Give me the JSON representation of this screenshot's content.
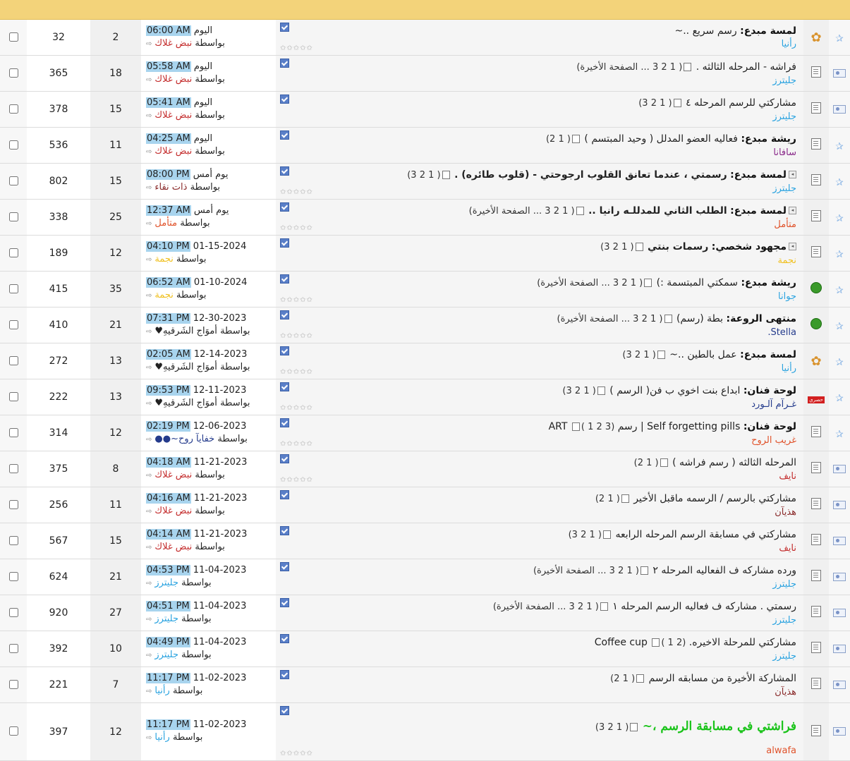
{
  "colors": {
    "header_bar": "#f3d37a",
    "time_highlight": "#a8d4ee",
    "green_title": "#19c319"
  },
  "threads": [
    {
      "views": "32",
      "replies": "2",
      "last_date": "اليوم",
      "last_time": "06:00 AM",
      "last_by_label": "بواسطة",
      "last_by": "نبض غلاك",
      "last_by_color": "c-red",
      "prefix": "لمسة مبدع:",
      "title": "رسم سريع ..~",
      "pages": "",
      "author": "رأنيا",
      "author_color": "c-blue",
      "thread_icon": "flower",
      "status_icon": "pin",
      "stars": true
    },
    {
      "views": "365",
      "replies": "18",
      "last_date": "اليوم",
      "last_time": "05:58 AM",
      "last_by_label": "بواسطة",
      "last_by": "نبض غلاك",
      "last_by_color": "c-red",
      "prefix": "",
      "title": "فراشه - المرحله الثالثه .",
      "pages": "( 1 2 3 ... الصفحة الأخيرة)",
      "author": "جليترز",
      "author_color": "c-blue",
      "thread_icon": "doc",
      "status_icon": "mail",
      "stars": false
    },
    {
      "views": "378",
      "replies": "15",
      "last_date": "اليوم",
      "last_time": "05:41 AM",
      "last_by_label": "بواسطة",
      "last_by": "نبض غلاك",
      "last_by_color": "c-red",
      "prefix": "",
      "title": "مشاركتي للرسم المرحله ٤",
      "pages": "( 1 2 3)",
      "author": "جليترز",
      "author_color": "c-blue",
      "thread_icon": "doc",
      "status_icon": "mail",
      "stars": false
    },
    {
      "views": "536",
      "replies": "11",
      "last_date": "اليوم",
      "last_time": "04:25 AM",
      "last_by_label": "بواسطة",
      "last_by": "نبض غلاك",
      "last_by_color": "c-red",
      "prefix": "ريشة مبدع:",
      "title": "فعاليه العضو المدلل ( وحيد المبتسم )",
      "pages": "( 1 2)",
      "author": "سافانا",
      "author_color": "c-purple",
      "thread_icon": "doc",
      "status_icon": "pin",
      "stars": false
    },
    {
      "views": "802",
      "replies": "15",
      "last_date": "يوم أمس",
      "last_time": "08:00 PM",
      "last_by_label": "بواسطة",
      "last_by": "ذات نقاء",
      "last_by_color": "c-maroon",
      "prefix": "لمسة مبدع:",
      "title": "رسمتي ، عندما تعانق القلوب ارجوحتي - (قلوب طائره) .",
      "pages": "( 1 2 3)",
      "author": "جليترز",
      "author_color": "c-blue",
      "thread_icon": "doc",
      "status_icon": "pin",
      "stars": true,
      "bold_title": true,
      "arrow_box": true
    },
    {
      "views": "338",
      "replies": "25",
      "last_date": "يوم أمس",
      "last_time": "12:37 AM",
      "last_by_label": "بواسطة",
      "last_by": "متأمل",
      "last_by_color": "c-orange",
      "prefix": "لمسة مبدع:",
      "title": "الطلب الثاني للمدللـه رانيا ..",
      "pages": "( 1 2 3 ... الصفحة الأخيرة)",
      "author": "متأمل",
      "author_color": "c-orange",
      "thread_icon": "doc",
      "status_icon": "pin",
      "stars": true,
      "bold_title": true,
      "arrow_box": true
    },
    {
      "views": "189",
      "replies": "12",
      "last_date": "01-15-2024",
      "last_time": "04:10 PM",
      "last_by_label": "بواسطة",
      "last_by": "نجمة",
      "last_by_color": "c-gold",
      "prefix": "مجهود شخصي:",
      "title": "رسمات بنتي",
      "pages": "( 1 2 3)",
      "author": "نجمة",
      "author_color": "c-gold",
      "thread_icon": "doc",
      "status_icon": "pin",
      "stars": false,
      "bold_title": true,
      "arrow_box": true
    },
    {
      "views": "415",
      "replies": "35",
      "last_date": "01-10-2024",
      "last_time": "06:52 AM",
      "last_by_label": "بواسطة",
      "last_by": "نجمة",
      "last_by_color": "c-gold",
      "prefix": "ريشة مبدع:",
      "title": "سمكتي المبتسمة :)",
      "pages": "( 1 2 3 ... الصفحة الأخيرة)",
      "author": "جوانا",
      "author_color": "c-blue",
      "thread_icon": "globe",
      "status_icon": "pin",
      "stars": true
    },
    {
      "views": "410",
      "replies": "21",
      "last_date": "12-30-2023",
      "last_time": "07:31 PM",
      "last_by_label": "بواسطة",
      "last_by": "أموَاج الشَرقيهِ♥",
      "last_by_color": "c-dark",
      "prefix": "منتهى الروعة:",
      "title": "بطة (رسم)",
      "pages": "( 1 2 3 ... الصفحة الأخيرة)",
      "author": "Stella.",
      "author_color": "c-navy",
      "thread_icon": "globe",
      "status_icon": "pin",
      "stars": true
    },
    {
      "views": "272",
      "replies": "13",
      "last_date": "12-14-2023",
      "last_time": "02:05 AM",
      "last_by_label": "بواسطة",
      "last_by": "أموَاج الشَرقيهِ♥",
      "last_by_color": "c-dark",
      "prefix": "لمسة مبدع:",
      "title": "عمل بالطين ..~",
      "pages": "( 1 2 3)",
      "author": "رأنيا",
      "author_color": "c-blue",
      "thread_icon": "flower",
      "status_icon": "pin",
      "stars": true
    },
    {
      "views": "222",
      "replies": "13",
      "last_date": "12-11-2023",
      "last_time": "09:53 PM",
      "last_by_label": "بواسطة",
      "last_by": "أموَاج الشَرقيهِ♥",
      "last_by_color": "c-dark",
      "prefix": "لوحة فنان:",
      "title": "ابداع بنت اخوي ب فن( الرسم )",
      "pages": "( 1 2 3)",
      "author": "غـرآم آلـورد",
      "author_color": "c-navy",
      "thread_icon": "exclusive",
      "thread_icon_label": "حصري",
      "status_icon": "pin",
      "stars": true
    },
    {
      "views": "314",
      "replies": "12",
      "last_date": "12-06-2023",
      "last_time": "02:19 PM",
      "last_by_label": "بواسطة",
      "last_by": "خفايآ روح~●●",
      "last_by_color": "c-navy",
      "prefix": "لوحة فنان:",
      "title": "Self forgetting pills | رسم ART",
      "pages": "( 1 2 3)",
      "author": "غريب الروح",
      "author_color": "c-orange",
      "thread_icon": "doc",
      "status_icon": "pin",
      "stars": true
    },
    {
      "views": "375",
      "replies": "8",
      "last_date": "11-21-2023",
      "last_time": "04:18 AM",
      "last_by_label": "بواسطة",
      "last_by": "نبض غلاك",
      "last_by_color": "c-red",
      "prefix": "",
      "title": "المرحله الثالثه ( رسم فراشه )",
      "pages": "( 1 2)",
      "author": "نايف",
      "author_color": "c-red",
      "thread_icon": "doc",
      "status_icon": "mail",
      "stars": true
    },
    {
      "views": "256",
      "replies": "11",
      "last_date": "11-21-2023",
      "last_time": "04:16 AM",
      "last_by_label": "بواسطة",
      "last_by": "نبض غلاك",
      "last_by_color": "c-red",
      "prefix": "",
      "title": "مشاركتي بالرسم / الرسمه ماقبل الأخير",
      "pages": "( 1 2)",
      "author": "هذيآن",
      "author_color": "c-maroon",
      "thread_icon": "doc",
      "status_icon": "mail",
      "stars": false
    },
    {
      "views": "567",
      "replies": "15",
      "last_date": "11-21-2023",
      "last_time": "04:14 AM",
      "last_by_label": "بواسطة",
      "last_by": "نبض غلاك",
      "last_by_color": "c-red",
      "prefix": "",
      "title": "مشاركتي في مسابقة الرسم المرحله الرابعه",
      "pages": "( 1 2 3)",
      "author": "نايف",
      "author_color": "c-red",
      "thread_icon": "doc",
      "status_icon": "mail",
      "stars": false
    },
    {
      "views": "624",
      "replies": "21",
      "last_date": "11-04-2023",
      "last_time": "04:53 PM",
      "last_by_label": "بواسطة",
      "last_by": "جليترز",
      "last_by_color": "c-blue",
      "prefix": "",
      "title": "ورده مشاركه ف الفعاليه المرحله ٢",
      "pages": "( 1 2 3 ... الصفحة الأخيرة)",
      "author": "جليترز",
      "author_color": "c-blue",
      "thread_icon": "doc",
      "status_icon": "mail",
      "stars": false
    },
    {
      "views": "920",
      "replies": "27",
      "last_date": "11-04-2023",
      "last_time": "04:51 PM",
      "last_by_label": "بواسطة",
      "last_by": "جليترز",
      "last_by_color": "c-blue",
      "prefix": "",
      "title": "رسمتي . مشاركه ف فعاليه الرسم المرحله ١",
      "pages": "( 1 2 3 ... الصفحة الأخيرة)",
      "author": "جليترز",
      "author_color": "c-blue",
      "thread_icon": "doc",
      "status_icon": "mail",
      "stars": false
    },
    {
      "views": "392",
      "replies": "10",
      "last_date": "11-04-2023",
      "last_time": "04:49 PM",
      "last_by_label": "بواسطة",
      "last_by": "جليترز",
      "last_by_color": "c-blue",
      "prefix": "",
      "title": "مشاركتي للمرحلة الاخيره. Coffee cup",
      "pages": "( 1 2)",
      "author": "جليترز",
      "author_color": "c-blue",
      "thread_icon": "doc",
      "status_icon": "mail",
      "stars": false
    },
    {
      "views": "221",
      "replies": "7",
      "last_date": "11-02-2023",
      "last_time": "11:17 PM",
      "last_by_label": "بواسطة",
      "last_by": "رأنيا",
      "last_by_color": "c-blue",
      "prefix": "",
      "title": "المشاركة الأخيرة من مسابقه الرسم",
      "pages": "( 1 2)",
      "author": "هذيآن",
      "author_color": "c-maroon",
      "thread_icon": "doc",
      "status_icon": "mail",
      "stars": false
    },
    {
      "views": "397",
      "replies": "12",
      "last_date": "11-02-2023",
      "last_time": "11:17 PM",
      "last_by_label": "بواسطة",
      "last_by": "رأنيا",
      "last_by_color": "c-blue",
      "prefix": "",
      "title": "فراشتي في مسابقة الرسم ،~",
      "pages": "( 1 2 3)",
      "author": "alwafa",
      "author_color": "c-orange",
      "thread_icon": "doc",
      "status_icon": "mail",
      "stars": true,
      "fancy": true
    }
  ]
}
